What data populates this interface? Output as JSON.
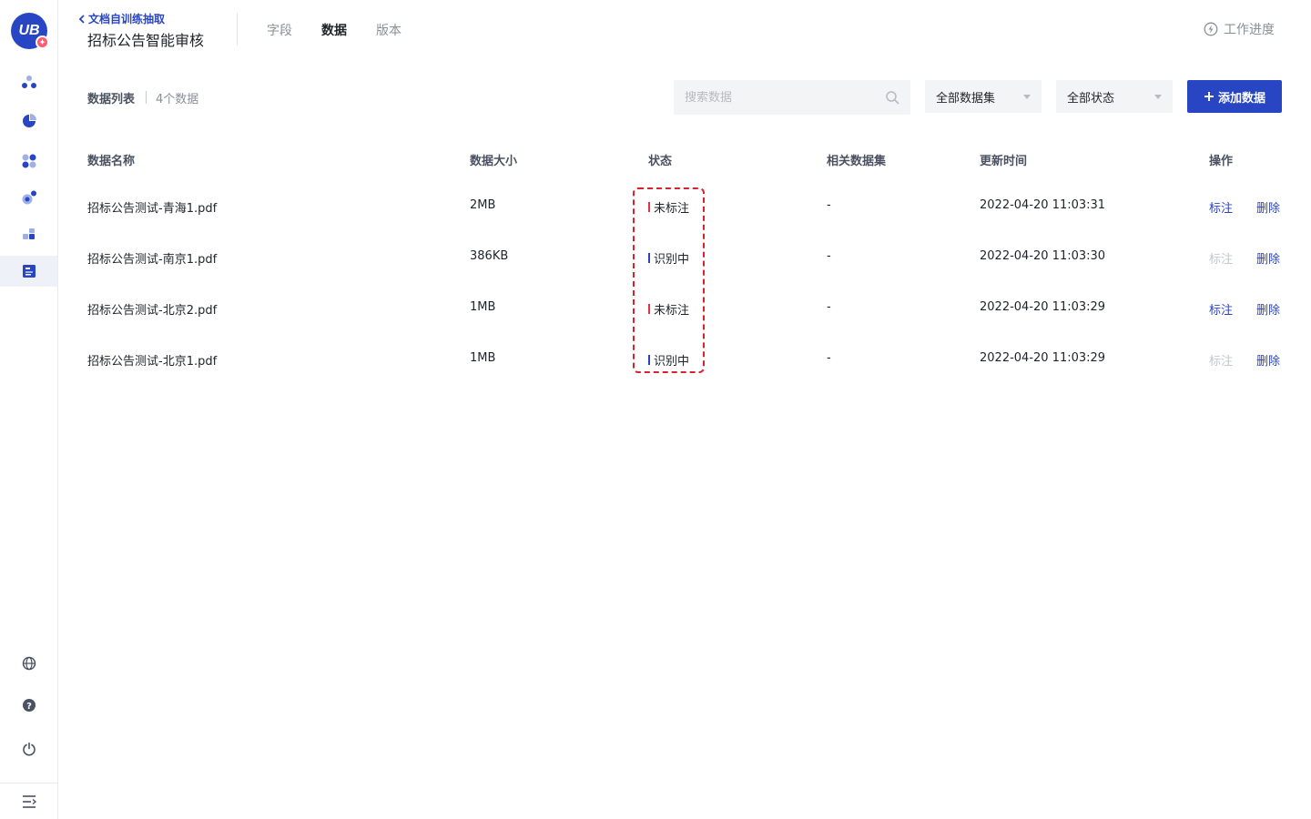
{
  "sidebar": {
    "logo_text": "UB",
    "logo_badge": "✦",
    "accent": "#2845c4",
    "items": [
      {
        "icon": "nodes-icon"
      },
      {
        "icon": "pie-chart-icon"
      },
      {
        "icon": "apps-icon"
      },
      {
        "icon": "bubbles-icon"
      },
      {
        "icon": "blocks-icon"
      },
      {
        "icon": "document-list-icon",
        "active": true
      }
    ],
    "bottom_items": [
      {
        "icon": "globe-icon"
      },
      {
        "icon": "help-icon"
      },
      {
        "icon": "power-icon"
      },
      {
        "icon": "collapse-menu-icon"
      }
    ]
  },
  "header": {
    "back_label": "文档自训练抽取",
    "title": "招标公告智能审核",
    "tabs": [
      {
        "label": "字段",
        "active": false
      },
      {
        "label": "数据",
        "active": true
      },
      {
        "label": "版本",
        "active": false
      }
    ],
    "work_progress_label": "工作进度"
  },
  "toolbar": {
    "list_title": "数据列表",
    "count_text": "4个数据",
    "search_placeholder": "搜索数据",
    "dataset_filter": "全部数据集",
    "status_filter": "全部状态",
    "add_label": "添加数据"
  },
  "table": {
    "columns": [
      "数据名称",
      "数据大小",
      "状态",
      "相关数据集",
      "更新时间",
      "操作"
    ],
    "rows": [
      {
        "name": "招标公告测试-青海1.pdf",
        "size": "2MB",
        "status": "未标注",
        "status_color": "#e5343f",
        "dataset": "-",
        "updated": "2022-04-20 11:03:31",
        "label_action": "标注",
        "label_enabled": true,
        "delete_action": "删除"
      },
      {
        "name": "招标公告测试-南京1.pdf",
        "size": "386KB",
        "status": "识别中",
        "status_color": "#2845c4",
        "dataset": "-",
        "updated": "2022-04-20 11:03:30",
        "label_action": "标注",
        "label_enabled": false,
        "delete_action": "删除"
      },
      {
        "name": "招标公告测试-北京2.pdf",
        "size": "1MB",
        "status": "未标注",
        "status_color": "#e5343f",
        "dataset": "-",
        "updated": "2022-04-20 11:03:29",
        "label_action": "标注",
        "label_enabled": true,
        "delete_action": "删除"
      },
      {
        "name": "招标公告测试-北京1.pdf",
        "size": "1MB",
        "status": "识别中",
        "status_color": "#2845c4",
        "dataset": "-",
        "updated": "2022-04-20 11:03:29",
        "label_action": "标注",
        "label_enabled": false,
        "delete_action": "删除"
      }
    ]
  }
}
